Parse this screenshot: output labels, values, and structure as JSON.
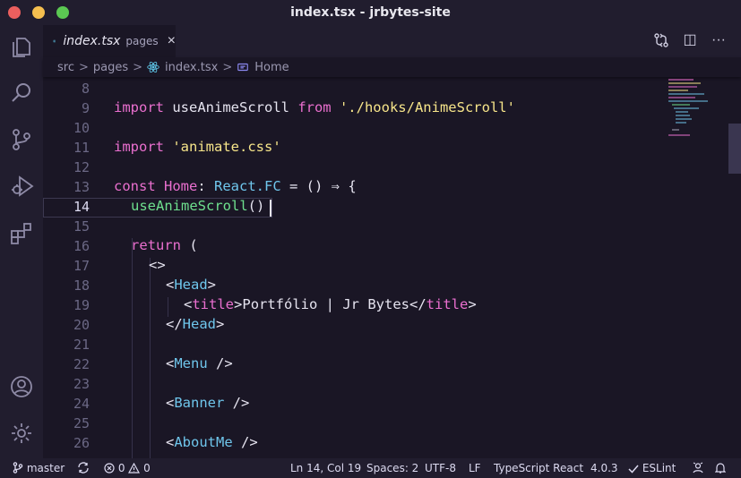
{
  "window": {
    "title": "index.tsx - jrbytes-site"
  },
  "activity_bar": {
    "items": [
      "explorer",
      "search",
      "source-control",
      "run-debug",
      "extensions",
      "accounts",
      "manage"
    ]
  },
  "tab": {
    "filename": "index.tsx",
    "directory": "pages",
    "close": "×"
  },
  "tab_actions": {
    "split": "◫",
    "more": "···"
  },
  "breadcrumb": {
    "parts": [
      "src",
      "pages",
      "index.tsx",
      "Home"
    ],
    "sep": ">"
  },
  "editor": {
    "line_numbers": [
      "8",
      "9",
      "10",
      "11",
      "12",
      "13",
      "14",
      "15",
      "16",
      "17",
      "18",
      "19",
      "20",
      "21",
      "22",
      "23",
      "24",
      "25",
      "26"
    ],
    "active_line": "14",
    "lines": {
      "l9": {
        "kw1": "import",
        "id": " useAnimeScroll ",
        "kw2": "from",
        "str": " './hooks/AnimeScroll'"
      },
      "l11": {
        "kw": "import",
        "str": " 'animate.css'"
      },
      "l13": {
        "kw": "const",
        "name": " Home",
        "colon": ": ",
        "type": "React.FC",
        "rest": " = () ⇒ {"
      },
      "l14": {
        "fn": "useAnimeScroll",
        "paren": "()"
      },
      "l16": {
        "kw": "return",
        "rest": " ("
      },
      "l17": {
        "frag": "<>"
      },
      "l18": {
        "open": "<",
        "tag": "Head",
        "close": ">"
      },
      "l19": {
        "open": "<",
        "tag": "title",
        "close": ">",
        "text": "Portfólio | Jr Bytes",
        "open2": "</",
        "tag2": "title",
        "close2": ">"
      },
      "l20": {
        "open": "</",
        "tag": "Head",
        "close": ">"
      },
      "l22": {
        "open": "<",
        "tag": "Menu",
        "close": " />"
      },
      "l24": {
        "open": "<",
        "tag": "Banner",
        "close": " />"
      },
      "l26": {
        "open": "<",
        "tag": "AboutMe",
        "close": " />"
      }
    }
  },
  "status_bar": {
    "branch": "master",
    "errors": "0",
    "warnings": "0",
    "position": "Ln 14, Col 19",
    "spaces": "Spaces: 2",
    "encoding": "UTF-8",
    "eol": "LF",
    "language": "TypeScript React",
    "version": "4.0.3",
    "eslint": "ESLint"
  },
  "colors": {
    "background": "#1a1625",
    "keyword": "#ea6fcf",
    "string": "#f7e58a",
    "function": "#6ee08e",
    "type": "#6fc6ec"
  }
}
